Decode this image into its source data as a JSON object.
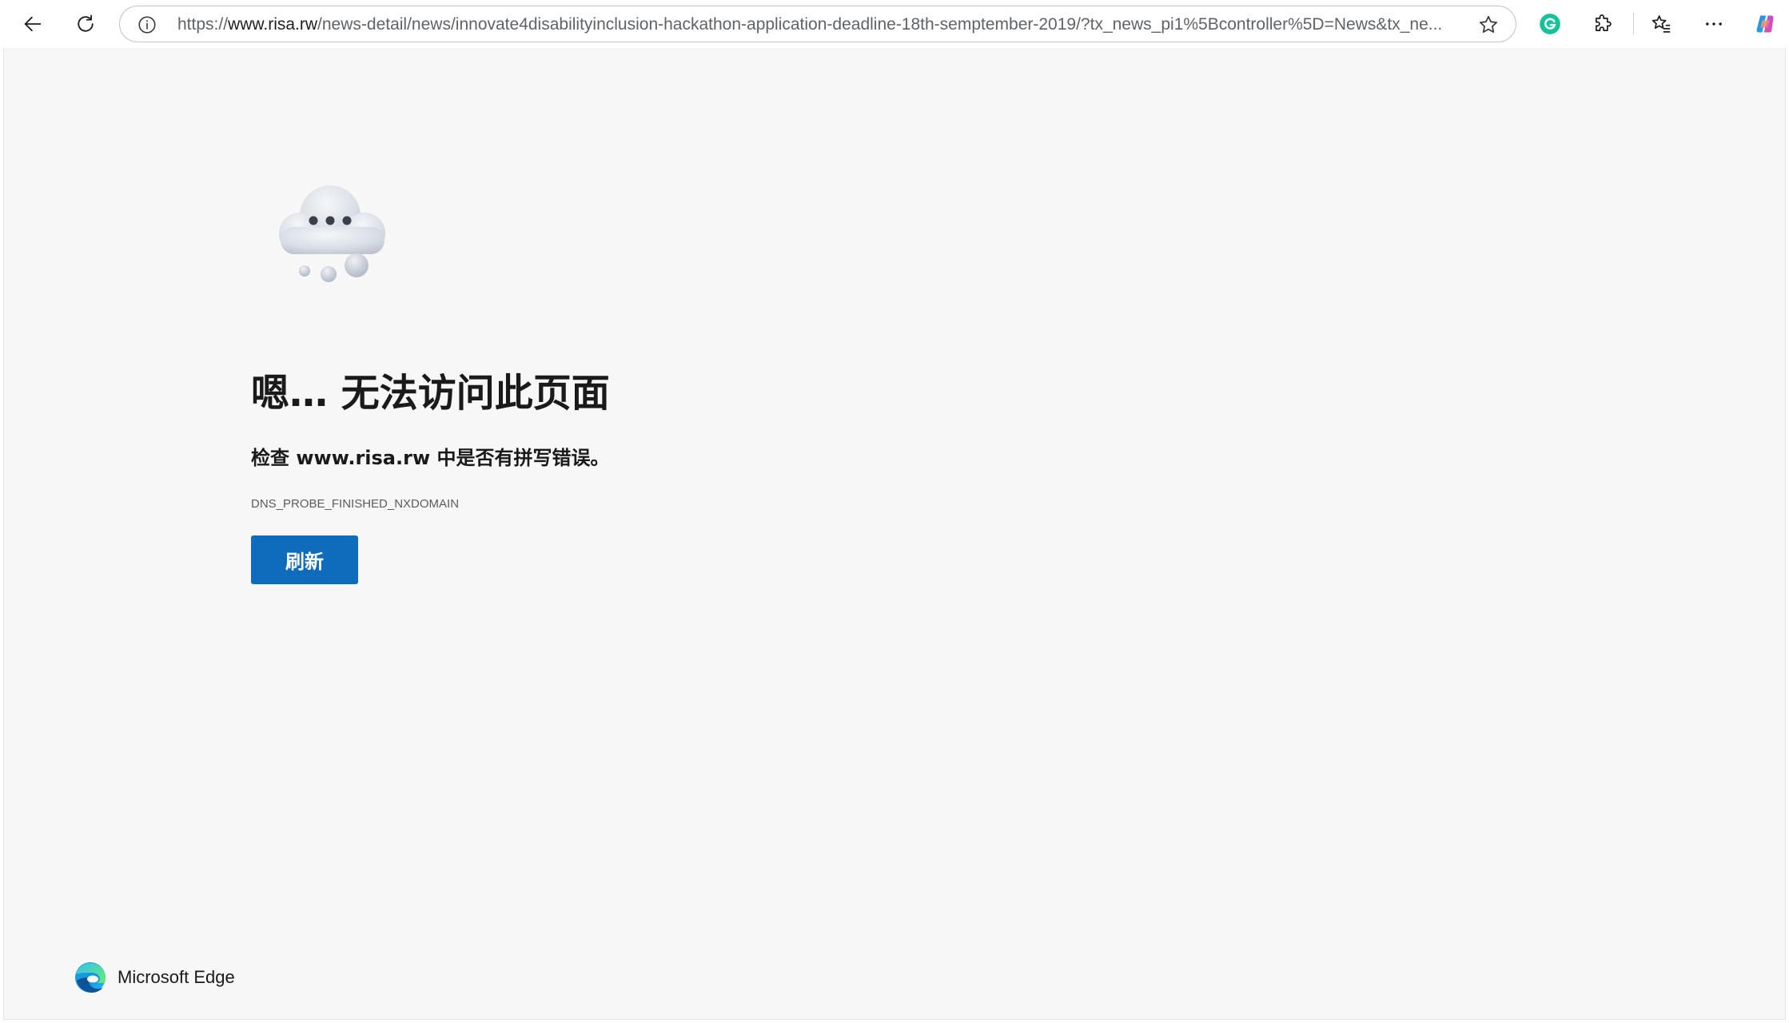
{
  "browser": {
    "url_host_prefix": "https://",
    "url_host": "www.risa.rw",
    "url_rest": "/news-detail/news/innovate4disabilityinclusion-hackathon-application-deadline-18th-semptember-2019/?tx_news_pi1%5Bcontroller%5D=News&tx_ne...",
    "icons": {
      "back": "back-arrow-icon",
      "reload": "reload-icon",
      "info": "info-icon",
      "favorite": "star-icon",
      "grammarly": "grammarly-icon",
      "extensions": "puzzle-icon",
      "favorites": "favorites-icon",
      "more": "more-icon",
      "copilot": "copilot-icon"
    }
  },
  "error_page": {
    "title": "嗯… 无法访问此页面",
    "description": "检查 www.risa.rw 中是否有拼写错误。",
    "error_code": "DNS_PROBE_FINISHED_NXDOMAIN",
    "refresh_label": "刷新",
    "accent_color": "#0f6cbd"
  },
  "footer": {
    "brand_label": "Microsoft Edge"
  }
}
